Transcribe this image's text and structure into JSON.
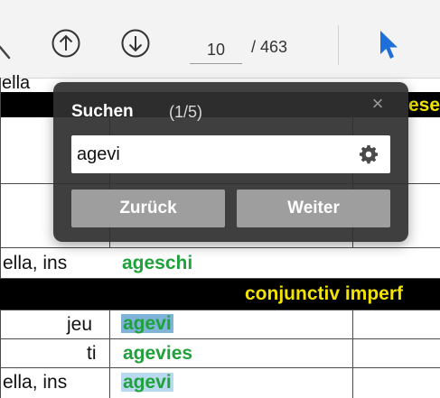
{
  "toolbar": {
    "page_current": "10",
    "page_total": "/ 463",
    "icons": {
      "prev": "arrow-up-circle-icon",
      "next": "arrow-down-circle-icon",
      "select": "cursor-arrow-icon"
    },
    "accent_color": "#1e6fd9"
  },
  "search": {
    "title": "Suchen",
    "count": "(1/5)",
    "close_glyph": "×",
    "query": "agevi",
    "back_label": "Zurück",
    "next_label": "Weiter",
    "settings_icon": "gear-icon"
  },
  "document": {
    "top_fragment": "ella",
    "heading_fragment": "ese",
    "heading2": "conjunctiv imperf",
    "rows": [
      {
        "pronoun": "ella, ins",
        "verb": "ageschi"
      },
      {
        "pronoun": "jeu",
        "verb": "agevi"
      },
      {
        "pronoun": "ti",
        "verb": "agevies"
      },
      {
        "pronoun": "ella, ins",
        "verb": "agevi"
      }
    ],
    "colors": {
      "verb": "#1fa13b",
      "heading_text": "#f2e300",
      "heading_bg": "#000000",
      "match_highlight": "#b9d9ef",
      "active_match": "#7fb4d8"
    }
  }
}
